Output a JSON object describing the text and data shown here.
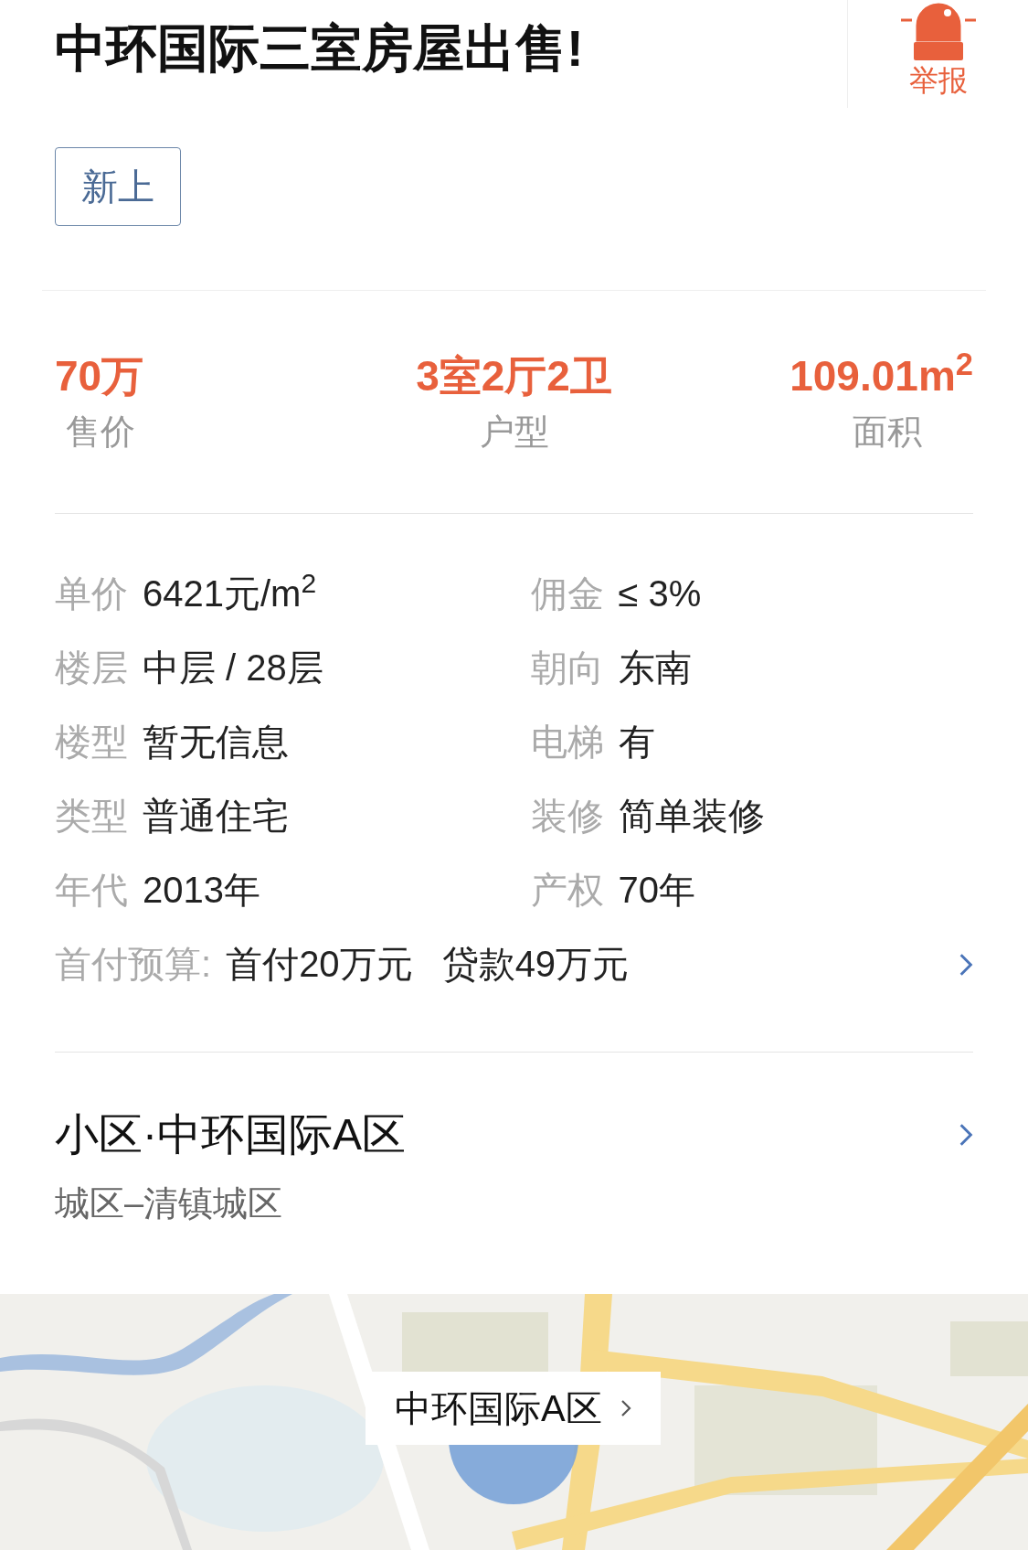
{
  "title": "中环国际三室房屋出售!",
  "report": {
    "label": "举报"
  },
  "tags": [
    {
      "label": "新上"
    }
  ],
  "stats": [
    {
      "value": "70万",
      "label": "售价"
    },
    {
      "value": "3室2厅2卫",
      "label": "户型"
    },
    {
      "value": "109.01m$^{2}$",
      "label": "面积"
    }
  ],
  "details": [
    {
      "label": "单价",
      "value": "6421元/m$^{2}$"
    },
    {
      "label": "佣金",
      "value": "≤ 3%"
    },
    {
      "label": "楼层",
      "value": "中层 / 28层"
    },
    {
      "label": "朝向",
      "value": "东南"
    },
    {
      "label": "楼型",
      "value": "暂无信息"
    },
    {
      "label": "电梯",
      "value": "有"
    },
    {
      "label": "类型",
      "value": "普通住宅"
    },
    {
      "label": "装修",
      "value": "简单装修"
    },
    {
      "label": "年代",
      "value": "2013年"
    },
    {
      "label": "产权",
      "value": "70年"
    }
  ],
  "budget": {
    "label": "首付预算:",
    "down_payment": "首付20万元",
    "loan": "贷款49万元"
  },
  "community": {
    "title": "小区·中环国际A区",
    "district": "城区–清镇城区"
  },
  "map": {
    "kind": "picture",
    "callout": "中环国际A区"
  }
}
